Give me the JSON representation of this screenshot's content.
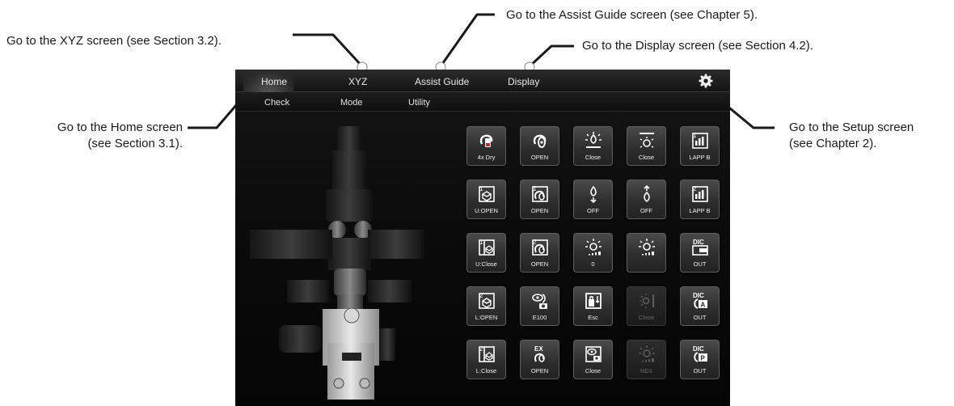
{
  "callouts": {
    "assist": "Go to the Assist Guide screen (see Chapter 5).",
    "xyz": "Go to the XYZ screen (see Section 3.2).",
    "display": "Go to the Display screen (see Section 4.2).",
    "home_line1": "Go to the Home screen",
    "home_line2": "(see Section 3.1).",
    "setup_line1": "Go to the Setup screen",
    "setup_line2": "(see Chapter 2)."
  },
  "tabs": [
    "Home",
    "XYZ",
    "Assist Guide",
    "Display"
  ],
  "active_tab": "Home",
  "subtabs": [
    "Check",
    "Mode",
    "Utility"
  ],
  "settings_icon": "gear-icon",
  "buttons": [
    [
      {
        "icon": "objective-dry-icon",
        "label": "4x Dry",
        "enabled": true
      },
      {
        "icon": "shutter-icon",
        "label": "OPEN",
        "enabled": true
      },
      {
        "icon": "lamp-shutter-icon",
        "label": "Close",
        "enabled": true
      },
      {
        "icon": "lamp-shutter-icon",
        "label": "Close",
        "enabled": true
      },
      {
        "icon": "lapp-port-1-icon",
        "label": "LAPP B",
        "enabled": true
      }
    ],
    [
      {
        "icon": "cube-1-icon",
        "label": "U:OPEN",
        "enabled": true
      },
      {
        "icon": "shutter-1-icon",
        "label": "OPEN",
        "enabled": true
      },
      {
        "icon": "focus-down-icon",
        "label": "OFF",
        "enabled": true
      },
      {
        "icon": "focus-up-icon",
        "label": "OFF",
        "enabled": true
      },
      {
        "icon": "lapp-port-2-icon",
        "label": "LAPP B",
        "enabled": true
      }
    ],
    [
      {
        "icon": "cube-close-1-icon",
        "label": "U:Close",
        "enabled": true
      },
      {
        "icon": "shutter-2-icon",
        "label": "OPEN",
        "enabled": true
      },
      {
        "icon": "nd-filter-icon",
        "label": "0",
        "enabled": true
      },
      {
        "icon": "nd-filter-icon",
        "label": "",
        "enabled": true
      },
      {
        "icon": "dic-slider-icon",
        "label": "OUT",
        "enabled": true
      }
    ],
    [
      {
        "icon": "cube-2-icon",
        "label": "L:OPEN",
        "enabled": true
      },
      {
        "icon": "camera-port-icon",
        "label": "E100",
        "enabled": true
      },
      {
        "icon": "escape-icon",
        "label": "Esc",
        "enabled": true
      },
      {
        "icon": "epi-shutter-icon",
        "label": "Close",
        "enabled": false
      },
      {
        "icon": "dic-analyzer-icon",
        "label": "OUT",
        "enabled": true
      }
    ],
    [
      {
        "icon": "cube-close-2-icon",
        "label": "L:Close",
        "enabled": true
      },
      {
        "icon": "ex-shutter-icon",
        "label": "OPEN",
        "enabled": true
      },
      {
        "icon": "camera-close-icon",
        "label": "Close",
        "enabled": true
      },
      {
        "icon": "nd-lamp-icon",
        "label": "ND1",
        "enabled": false
      },
      {
        "icon": "dic-polarizer-icon",
        "label": "OUT",
        "enabled": true
      }
    ]
  ]
}
